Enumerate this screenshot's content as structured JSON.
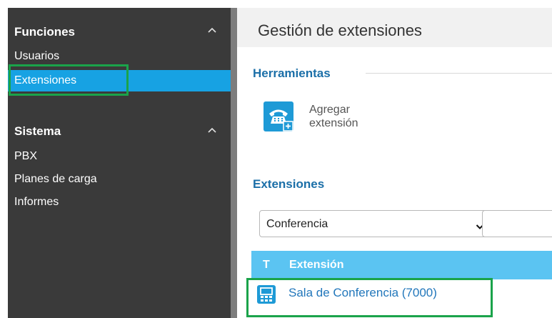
{
  "sidebar": {
    "sections": [
      {
        "title": "Funciones",
        "items": [
          "Usuarios",
          "Extensiones"
        ]
      },
      {
        "title": "Sistema",
        "items": [
          "PBX",
          "Planes de carga",
          "Informes"
        ]
      }
    ],
    "active_item": "Extensiones"
  },
  "main": {
    "title": "Gestión de extensiones",
    "tools_title": "Herramientas",
    "add_extension": {
      "line1": "Agregar",
      "line2": "extensión"
    },
    "extensions_title": "Extensiones",
    "filter_select": {
      "value": "Conferencia"
    },
    "search_input": {
      "value": ""
    },
    "table": {
      "headers": [
        "T",
        "Extensión"
      ],
      "rows": [
        {
          "name": "Sala de Conferencia (7000)"
        }
      ]
    }
  },
  "colors": {
    "sidebar_bg": "#3a3a3a",
    "active_bg": "#17a2e3",
    "highlight": "#1aa34a",
    "accent": "#1e9ad6",
    "table_header": "#5bc4f2",
    "section_title": "#1b6fa8"
  },
  "icons": [
    "chevron-up-icon",
    "phone-add-icon",
    "chevron-down-icon",
    "conference-phone-icon"
  ]
}
